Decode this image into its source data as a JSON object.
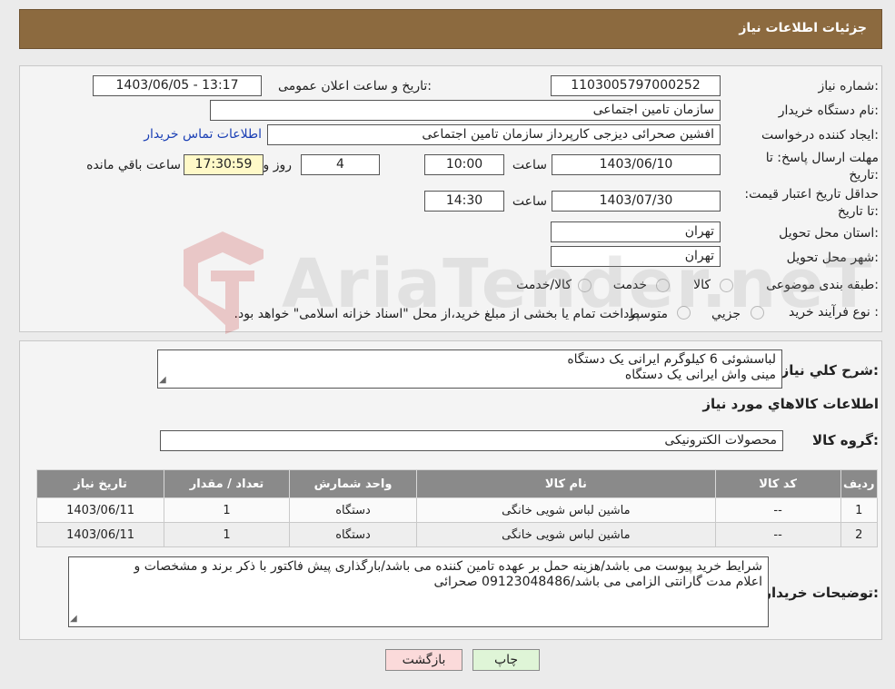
{
  "header": {
    "title": "جزئیات اطلاعات نیاز"
  },
  "colors": {
    "header_bg": "#8c6a3f",
    "print_button_bg": "#dff5d7",
    "back_button_bg": "#fbdada",
    "table_header_bg": "#8a8a8a"
  },
  "form": {
    "need_number_label": "شماره نیاز:",
    "need_number": "1103005797000252",
    "announce_label": "تاریخ و ساعت اعلان عمومی:",
    "announce_value": "1403/06/05 - 13:17",
    "buyer_label": "نام دستگاه خریدار:",
    "buyer": "سازمان تامین اجتماعی",
    "creator_label": "ایجاد کننده درخواست:",
    "creator": "افشین صحرائی دیزجی کارپرداز سازمان تامین اجتماعی",
    "contact_link": "اطلاعات تماس خریدار",
    "reply_deadline_label": "مهلت ارسال پاسخ: تا تاریخ:",
    "reply_date": "1403/06/10",
    "time_label": "ساعت",
    "reply_time": "10:00",
    "days": "4",
    "days_label": "روز و",
    "remaining": "17:30:59",
    "remaining_label": "ساعت باقي مانده",
    "validity_label": "حداقل تاریخ اعتبار قیمت: تا تاریخ:",
    "validity_date": "1403/07/30",
    "validity_time": "14:30",
    "province_label": "استان محل تحویل:",
    "province": "تهران",
    "city_label": "شهر محل تحویل:",
    "city": "تهران",
    "category_label": "طبقه بندی موضوعی:",
    "category_options": [
      "کالا",
      "خدمت",
      "کالا/خدمت"
    ],
    "process_label": "نوع فرآیند خرید :",
    "process_options": [
      "جزیي",
      "متوسط"
    ],
    "process_note": "پرداخت تمام یا بخشی از مبلغ خرید،از محل \"اسناد خزانه اسلامی\" خواهد بود."
  },
  "summary": {
    "label": "شرح کلي نیاز:",
    "lines": [
      "لباسشوئی 6 کیلوگرم ایرانی یک دستگاه",
      "مینی واش ایرانی یک دستگاه"
    ],
    "goods_info_title": "اطلاعات کالاهاي مورد نیاز",
    "group_label": "گروه کالا:",
    "group_value": "محصولات الکترونیکی"
  },
  "table": {
    "headers": [
      "ردیف",
      "کد کالا",
      "نام کالا",
      "واحد شمارش",
      "تعداد / مقدار",
      "تاریخ نیاز"
    ],
    "rows": [
      [
        "1",
        "--",
        "ماشین لباس شویی خانگی",
        "دستگاه",
        "1",
        "1403/06/11"
      ],
      [
        "2",
        "--",
        "ماشین لباس شویی خانگی",
        "دستگاه",
        "1",
        "1403/06/11"
      ]
    ]
  },
  "buyer_notes": {
    "label": "توضیحات خریدار:",
    "lines": [
      "شرایط خرید پیوست می باشد/هزینه حمل بر عهده تامین کننده می باشد/بارگذاری پیش فاکتور با ذکر برند و مشخصات و",
      "اعلام مدت گارانتی الزامی می باشد/09123048486 صحرائی"
    ]
  },
  "buttons": {
    "print": "چاپ",
    "back": "بازگشت"
  },
  "watermark": {
    "text": "AriaTender.neT"
  }
}
